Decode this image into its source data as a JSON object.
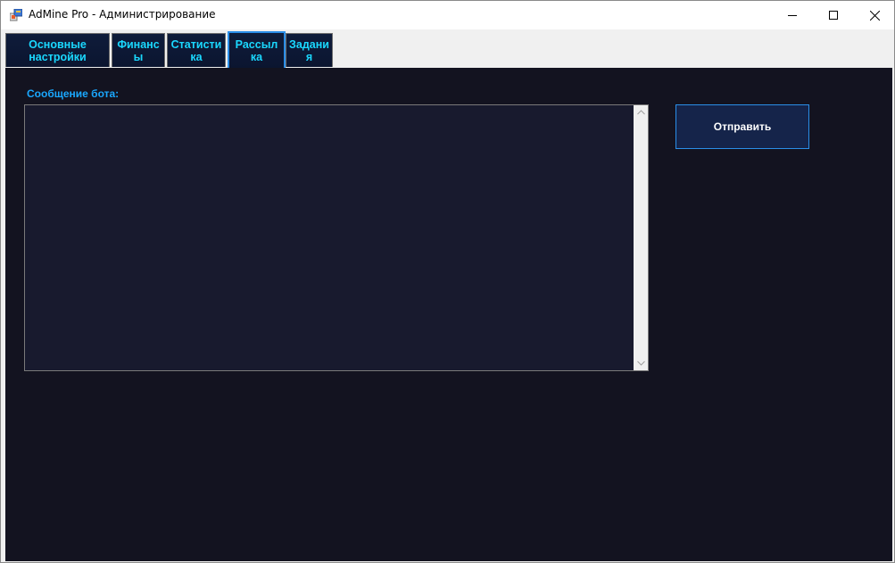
{
  "window": {
    "title": "AdMine Pro - Администрирование",
    "icon": "app-icon",
    "controls": [
      "minimize-icon",
      "maximize-icon",
      "close-icon"
    ]
  },
  "tabs": [
    {
      "line1": "Основные",
      "line2": "настройки",
      "active": false
    },
    {
      "line1": "Финанс",
      "line2": "ы",
      "active": false
    },
    {
      "line1": "Статисти",
      "line2": "ка",
      "active": false
    },
    {
      "line1": "Рассыл",
      "line2": "ка",
      "active": true
    },
    {
      "line1": "Задани",
      "line2": "я",
      "active": false
    }
  ],
  "broadcast": {
    "message_label": "Сообщение бота:",
    "message_value": "",
    "send_label": "Отправить"
  },
  "colors": {
    "tab_text": "#1ad8ff",
    "label_text": "#1aa8ff",
    "panel_bg": "#131320",
    "accent_border": "#2a8ee8"
  }
}
